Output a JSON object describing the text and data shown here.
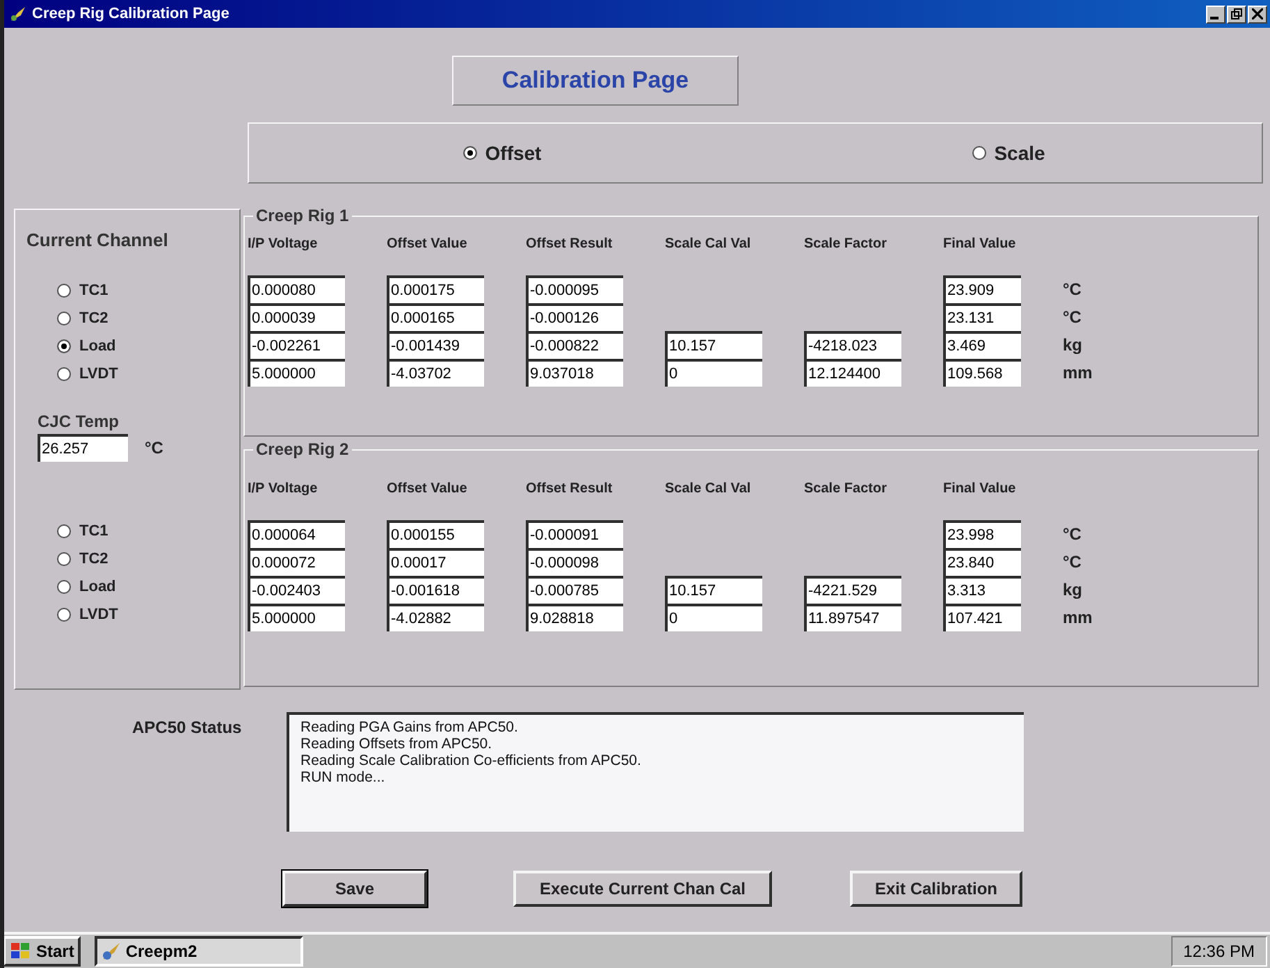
{
  "window": {
    "title": "Creep Rig Calibration Page"
  },
  "page_heading": "Calibration Page",
  "mode_options": [
    {
      "label": "Offset",
      "selected": true
    },
    {
      "label": "Scale",
      "selected": false
    }
  ],
  "channel_panel": {
    "title": "Current Channel",
    "cjc": {
      "label": "CJC Temp",
      "value": "26.257",
      "unit": "°C"
    }
  },
  "rigs": [
    {
      "title": "Creep Rig 1",
      "columns": [
        "I/P Voltage",
        "Offset Value",
        "Offset Result",
        "Scale Cal Val",
        "Scale Factor",
        "Final Value"
      ],
      "rows": [
        {
          "channel": "TC1",
          "selected": false,
          "ip_voltage": "0.000080",
          "offset_value": "0.000175",
          "offset_result": "-0.000095",
          "final_value": "23.909",
          "unit": "°C"
        },
        {
          "channel": "TC2",
          "selected": false,
          "ip_voltage": "0.000039",
          "offset_value": "0.000165",
          "offset_result": "-0.000126",
          "final_value": "23.131",
          "unit": "°C"
        },
        {
          "channel": "Load",
          "selected": true,
          "ip_voltage": "-0.002261",
          "offset_value": "-0.001439",
          "offset_result": "-0.000822",
          "scale_cal_val": "10.157",
          "scale_factor": "-4218.023",
          "final_value": "3.469",
          "unit": "kg"
        },
        {
          "channel": "LVDT",
          "selected": false,
          "ip_voltage": "5.000000",
          "offset_value": "-4.03702",
          "offset_result": "9.037018",
          "scale_cal_val": "0",
          "scale_factor": "12.124400",
          "final_value": "109.568",
          "unit": "mm"
        }
      ]
    },
    {
      "title": "Creep Rig 2",
      "columns": [
        "I/P Voltage",
        "Offset Value",
        "Offset Result",
        "Scale Cal Val",
        "Scale Factor",
        "Final Value"
      ],
      "rows": [
        {
          "channel": "TC1",
          "selected": false,
          "ip_voltage": "0.000064",
          "offset_value": "0.000155",
          "offset_result": "-0.000091",
          "final_value": "23.998",
          "unit": "°C"
        },
        {
          "channel": "TC2",
          "selected": false,
          "ip_voltage": "0.000072",
          "offset_value": "0.00017",
          "offset_result": "-0.000098",
          "final_value": "23.840",
          "unit": "°C"
        },
        {
          "channel": "Load",
          "selected": false,
          "ip_voltage": "-0.002403",
          "offset_value": "-0.001618",
          "offset_result": "-0.000785",
          "scale_cal_val": "10.157",
          "scale_factor": "-4221.529",
          "final_value": "3.313",
          "unit": "kg"
        },
        {
          "channel": "LVDT",
          "selected": false,
          "ip_voltage": "5.000000",
          "offset_value": "-4.02882",
          "offset_result": "9.028818",
          "scale_cal_val": "0",
          "scale_factor": "11.897547",
          "final_value": "107.421",
          "unit": "mm"
        }
      ]
    }
  ],
  "status": {
    "label": "APC50 Status",
    "lines": [
      "Reading PGA Gains from APC50.",
      "Reading Offsets from APC50.",
      "Reading Scale Calibration Co-efficients from APC50.",
      "RUN mode..."
    ]
  },
  "buttons": [
    {
      "label": "Save",
      "focused": true
    },
    {
      "label": "Execute Current Chan Cal",
      "focused": false
    },
    {
      "label": "Exit Calibration",
      "focused": false
    }
  ],
  "taskbar": {
    "start": "Start",
    "task": "Creepm2",
    "clock": "12:36 PM"
  }
}
